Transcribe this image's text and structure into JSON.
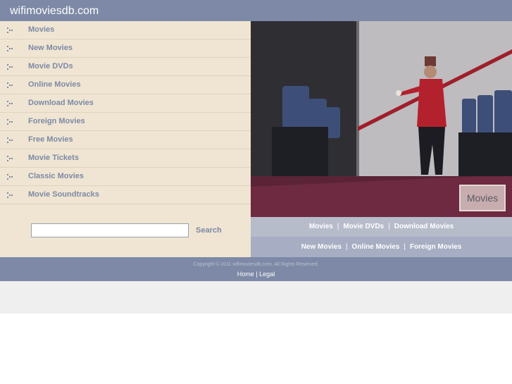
{
  "header": {
    "title": "wifimoviesdb.com"
  },
  "sidebar": {
    "items": [
      {
        "label": "Movies"
      },
      {
        "label": "New Movies"
      },
      {
        "label": "Movie DVDs"
      },
      {
        "label": "Online Movies"
      },
      {
        "label": "Download Movies"
      },
      {
        "label": "Foreign Movies"
      },
      {
        "label": "Free Movies"
      },
      {
        "label": "Movie Tickets"
      },
      {
        "label": "Classic Movies"
      },
      {
        "label": "Movie Soundtracks"
      }
    ],
    "bullet_icon": "dotted-bullet-icon"
  },
  "search": {
    "placeholder": "",
    "value": "",
    "button_label": "Search"
  },
  "hero": {
    "badge_label": "Movies"
  },
  "links": {
    "row1": [
      "Movies",
      "Movie DVDs",
      "Download Movies"
    ],
    "row2": [
      "New Movies",
      "Online Movies",
      "Foreign Movies"
    ],
    "separator": "|"
  },
  "footer": {
    "copyright": "Copyright © 2011 wifimoviesdb.com. All Rights Reserved.",
    "home_label": "Home",
    "separator": "|",
    "legal_label": "Legal"
  },
  "colors": {
    "header": "#7d89a6",
    "sidebar": "#efe5d2",
    "link_text": "#7d89a6",
    "links_row1": "#b7bccb",
    "links_row2": "#a7adc2"
  }
}
